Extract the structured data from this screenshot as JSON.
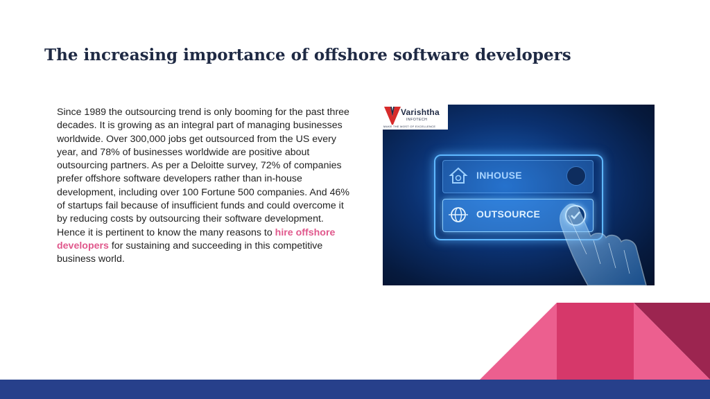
{
  "slide": {
    "title": "The increasing importance of offshore software developers",
    "paragraph_before_link": "Since 1989 the outsourcing trend is only booming for the past three decades. It is growing as an integral part of managing businesses worldwide. Over 300,000 jobs get outsourced from the US every year, and 78% of businesses worldwide are positive about outsourcing partners. As per a Deloitte survey, 72% of companies prefer offshore software developers rather than in-house development, including over 100 Fortune 500 companies. And 46% of startups fail because of insufficient funds and could overcome it by reducing costs by outsourcing their software development. Hence it is pertinent to know the many reasons to ",
    "link_text": "hire offshore developers",
    "paragraph_after_link": " for sustaining and succeeding in this competitive business world."
  },
  "image": {
    "logo_name": "Varishtha",
    "logo_sub": "INFOTECH",
    "logo_tagline": "MAKE THE MOST OF EXCELLENCE",
    "option_1": "INHOUSE",
    "option_2": "OUTSOURCE",
    "icons": [
      "house-icon",
      "globe-icon",
      "check-icon"
    ]
  },
  "colors": {
    "title": "#1f2a44",
    "link": "#e0588c",
    "bottom_bar": "#27408b",
    "pink": "#ec5f8f",
    "crimson": "#d6386a",
    "maroon": "#9c2550"
  }
}
